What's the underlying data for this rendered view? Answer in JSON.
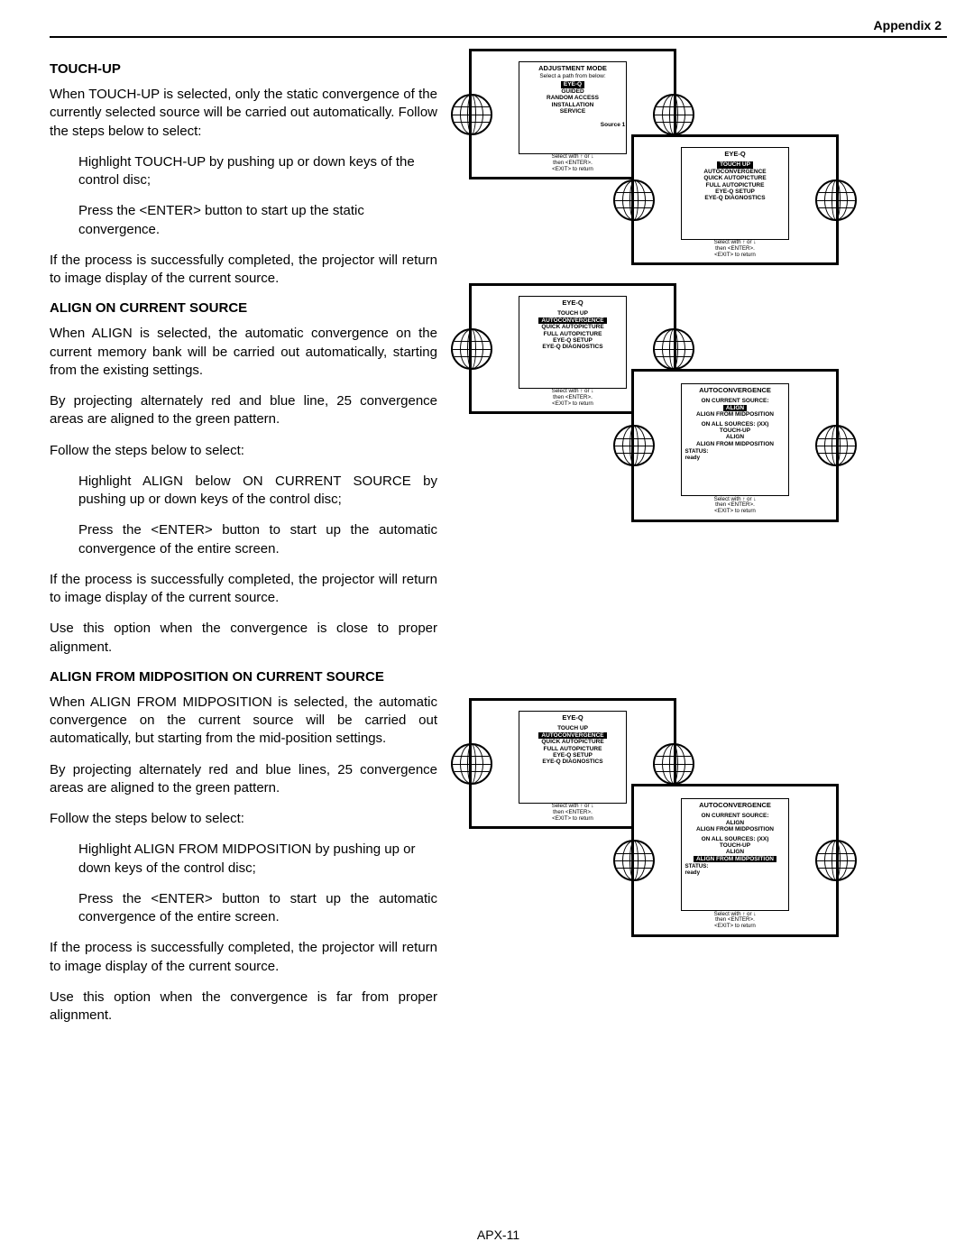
{
  "header": {
    "appendix": "Appendix 2"
  },
  "footer": {
    "page": "APX-11"
  },
  "body": {
    "s1": {
      "title": "TOUCH-UP",
      "p1": "When TOUCH-UP is selected, only the static convergence of the currently selected source will be carried out automatically.  Follow the steps below to select:",
      "li1": "Highlight TOUCH-UP by pushing up or down keys of the control disc;",
      "li2": "Press the <ENTER> button to start up the static convergence.",
      "p2": "If the process is successfully completed, the projector will return to image display of the current source."
    },
    "s2": {
      "title": "ALIGN ON CURRENT SOURCE",
      "p1": " When ALIGN is selected, the automatic convergence on the current memory bank will be carried out automatically, starting from the existing settings.",
      "p2": "By projecting alternately red and blue line, 25 convergence areas are aligned to the green pattern.",
      "p3": "Follow the steps below to select:",
      "li1": "Highlight ALIGN below ON CURRENT SOURCE  by pushing up or down keys of the control disc;",
      "li2": "Press the <ENTER> button to start up the automatic convergence of the entire screen.",
      "p4": "If the process is successfully completed, the projector will return to image display of the current source.",
      "p5": "Use this option when the convergence is close to proper alignment."
    },
    "s3": {
      "title": "ALIGN FROM MIDPOSITION ON CURRENT SOURCE",
      "p1": "When ALIGN FROM MIDPOSITION is selected, the automatic convergence on the current source will be carried out automatically, but starting from the mid-position settings.",
      "p2": "By projecting alternately red and blue lines, 25 convergence areas are aligned to the green pattern.",
      "p3": "Follow the steps below to select:",
      "li1": "Highlight ALIGN FROM MIDPOSITION by pushing up or down keys of the control disc;",
      "li2": "Press the <ENTER> button to start up the automatic convergence of the entire screen.",
      "p4": "If the process is successfully completed, the projector will return to image display of the current source.",
      "p5": "Use this option when the convergence is far from proper alignment."
    }
  },
  "menus": {
    "hintL1": "Select with ↑ or ↓",
    "hintL2": "then  <ENTER>.",
    "hintL3": "<EXIT>  to return",
    "adj": {
      "title": "ADJUSTMENT MODE",
      "sub": "Select a path from below:",
      "items": [
        "EYE-Q",
        "GUIDED",
        "RANDOM ACCESS",
        "INSTALLATION",
        "SERVICE"
      ],
      "selected": "EYE-Q",
      "source": "Source 1"
    },
    "eyeq1": {
      "title": "EYE-Q",
      "items": [
        "TOUCH UP",
        "AUTOCONVERGENCE",
        "QUICK AUTOPICTURE",
        "FULL AUTOPICTURE",
        "EYE-Q SETUP",
        "EYE-Q DIAGNOSTICS"
      ],
      "selected": "TOUCH UP"
    },
    "eyeq2": {
      "title": "EYE-Q",
      "items": [
        "TOUCH UP",
        "AUTOCONVERGENCE",
        "QUICK AUTOPICTURE",
        "FULL AUTOPICTURE",
        "EYE-Q SETUP",
        "EYE-Q DIAGNOSTICS"
      ],
      "selected": "AUTOCONVERGENCE"
    },
    "auto1": {
      "title": "AUTOCONVERGENCE",
      "g1": "ON CURRENT SOURCE:",
      "g1items": [
        "ALIGN",
        "ALIGN FROM MIDPOSITION"
      ],
      "g2": "ON ALL SOURCES:  (XX)",
      "g2items": [
        "TOUCH-UP",
        "ALIGN",
        "ALIGN FROM MIDPOSITION"
      ],
      "selected": "ALIGN",
      "statusL": "STATUS:",
      "statusV": "ready"
    },
    "eyeq3": {
      "title": "EYE-Q",
      "items": [
        "TOUCH UP",
        "AUTOCONVERGENCE",
        "QUICK AUTOPICTURE",
        "FULL AUTOPICTURE",
        "EYE-Q SETUP",
        "EYE-Q DIAGNOSTICS"
      ],
      "selected": "AUTOCONVERGENCE"
    },
    "auto2": {
      "title": "AUTOCONVERGENCE",
      "g1": "ON CURRENT SOURCE:",
      "g1items": [
        "ALIGN",
        "ALIGN FROM MIDPOSITION"
      ],
      "g2": "ON ALL SOURCES:  (XX)",
      "g2items": [
        "TOUCH-UP",
        "ALIGN",
        "ALIGN FROM MIDPOSITION"
      ],
      "selected": "ALIGN FROM MIDPOSITION",
      "statusL": "STATUS:",
      "statusV": "ready"
    }
  }
}
